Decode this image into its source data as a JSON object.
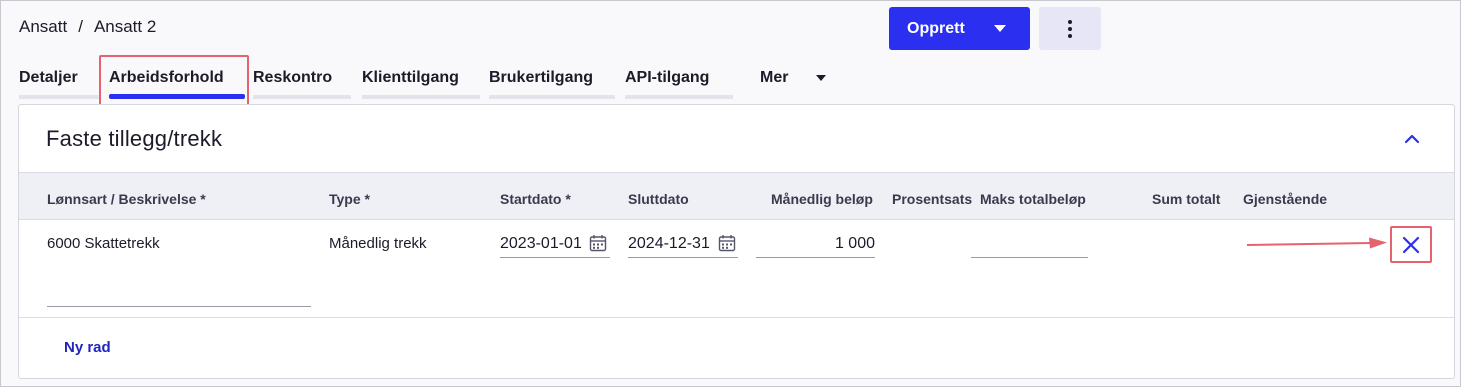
{
  "breadcrumb": {
    "parent": "Ansatt",
    "separator": "/",
    "current": "Ansatt 2"
  },
  "header": {
    "create_label": "Opprett",
    "create_icon": "chevron-down-icon",
    "more_icon": "kebab-icon"
  },
  "tabs": [
    {
      "label": "Detaljer"
    },
    {
      "label": "Arbeidsforhold",
      "active": true
    },
    {
      "label": "Reskontro"
    },
    {
      "label": "Klienttilgang"
    },
    {
      "label": "Brukertilgang"
    },
    {
      "label": "API-tilgang"
    },
    {
      "label": "Mer"
    }
  ],
  "section": {
    "title": "Faste tillegg/trekk",
    "columns": [
      "Lønnsart / Beskrivelse *",
      "Type *",
      "Startdato *",
      "Sluttdato",
      "Månedlig beløp",
      "Prosentsats",
      "Maks totalbeløp",
      "Sum totalt",
      "Gjenstående"
    ],
    "rows": [
      {
        "wage_type": "6000 Skattetrekk",
        "type": "Månedlig trekk",
        "start_date": "2023-01-01",
        "end_date": "2024-12-31",
        "monthly_amount": "1 000",
        "percentage": "",
        "max_total": "",
        "sum_total": "",
        "remaining": ""
      }
    ],
    "new_row_label": "Ny rad"
  },
  "colors": {
    "accent": "#2b2ff0",
    "highlight": "#e3636e",
    "link": "#2226b8"
  }
}
